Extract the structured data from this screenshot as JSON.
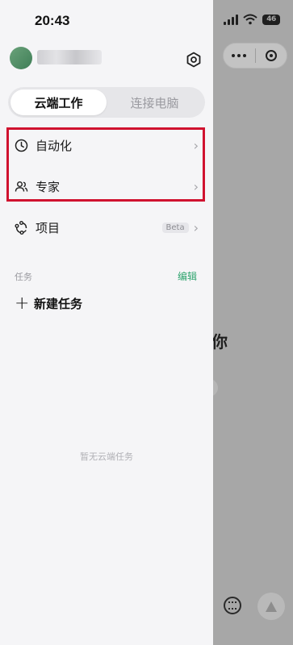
{
  "status_bar": {
    "time": "20:43",
    "battery": "46"
  },
  "capsule": {
    "more_icon": "more-dots-icon",
    "close_icon": "target-close-icon"
  },
  "background": {
    "glyph": "你"
  },
  "drawer": {
    "settings_icon": "hexagon-settings-icon",
    "segmented": [
      "云端工作",
      "连接电脑"
    ],
    "active_segment": 0,
    "menu": [
      {
        "label": "自动化",
        "icon": "clock-icon"
      },
      {
        "label": "专家",
        "icon": "people-icon"
      },
      {
        "label": "项目",
        "icon": "nodes-icon",
        "badge": "Beta"
      }
    ],
    "tasks": {
      "title": "任务",
      "edit": "编辑",
      "new_task": "新建任务",
      "empty": "暂无云端任务"
    }
  },
  "colors": {
    "accent_green": "#2fa46e",
    "highlight_red": "#d0122f"
  }
}
